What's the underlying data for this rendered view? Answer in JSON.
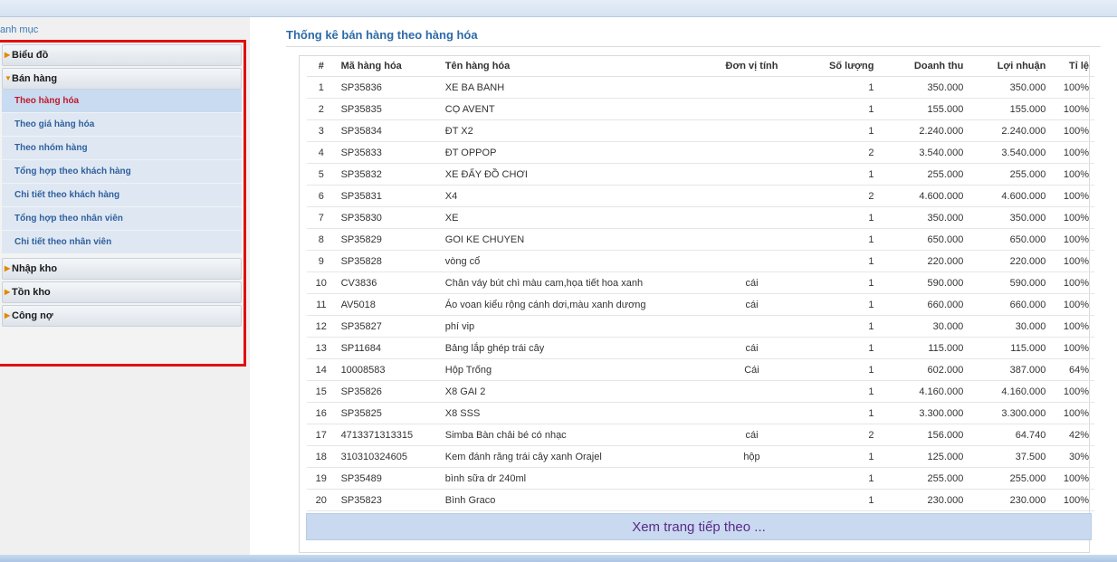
{
  "sidebar": {
    "title": "anh mục",
    "groups": {
      "chart": "Biểu đồ",
      "sales": "Bán hàng",
      "import": "Nhập kho",
      "stock": "Tồn kho",
      "debt": "Công nợ"
    },
    "sales_items": [
      "Theo hàng hóa",
      "Theo giá hàng hóa",
      "Theo nhóm hàng",
      "Tổng hợp theo khách hàng",
      "Chi tiết theo khách hàng",
      "Tổng hợp theo nhân viên",
      "Chi tiết theo nhân viên"
    ]
  },
  "main": {
    "title": "Thống kê bán hàng theo hàng hóa",
    "columns": [
      "#",
      "Mã hàng hóa",
      "Tên hàng hóa",
      "Đơn vị tính",
      "Số lượng",
      "Doanh thu",
      "Lợi nhuận",
      "Tỉ lệ"
    ],
    "rows": [
      [
        "1",
        "SP35836",
        "XE BA BANH",
        "",
        "1",
        "350.000",
        "350.000",
        "100%"
      ],
      [
        "2",
        "SP35835",
        "CỌ AVENT",
        "",
        "1",
        "155.000",
        "155.000",
        "100%"
      ],
      [
        "3",
        "SP35834",
        "ĐT X2",
        "",
        "1",
        "2.240.000",
        "2.240.000",
        "100%"
      ],
      [
        "4",
        "SP35833",
        "ĐT OPPOP",
        "",
        "2",
        "3.540.000",
        "3.540.000",
        "100%"
      ],
      [
        "5",
        "SP35832",
        "XE ĐẨY ĐỒ CHƠI",
        "",
        "1",
        "255.000",
        "255.000",
        "100%"
      ],
      [
        "6",
        "SP35831",
        "X4",
        "",
        "2",
        "4.600.000",
        "4.600.000",
        "100%"
      ],
      [
        "7",
        "SP35830",
        "XE",
        "",
        "1",
        "350.000",
        "350.000",
        "100%"
      ],
      [
        "8",
        "SP35829",
        "GOI KE CHUYEN",
        "",
        "1",
        "650.000",
        "650.000",
        "100%"
      ],
      [
        "9",
        "SP35828",
        "vòng cổ",
        "",
        "1",
        "220.000",
        "220.000",
        "100%"
      ],
      [
        "10",
        "CV3836",
        "Chân váy bút chì màu cam,họa tiết hoa xanh",
        "cái",
        "1",
        "590.000",
        "590.000",
        "100%"
      ],
      [
        "11",
        "AV5018",
        "Áo voan kiểu rộng cánh dơi,màu xanh dương",
        "cái",
        "1",
        "660.000",
        "660.000",
        "100%"
      ],
      [
        "12",
        "SP35827",
        "phí vip",
        "",
        "1",
        "30.000",
        "30.000",
        "100%"
      ],
      [
        "13",
        "SP11684",
        "Bảng lắp ghép trái cây",
        "cái",
        "1",
        "115.000",
        "115.000",
        "100%"
      ],
      [
        "14",
        "10008583",
        "Hộp Trống",
        "Cái",
        "1",
        "602.000",
        "387.000",
        "64%"
      ],
      [
        "15",
        "SP35826",
        "X8 GAI 2",
        "",
        "1",
        "4.160.000",
        "4.160.000",
        "100%"
      ],
      [
        "16",
        "SP35825",
        "X8 SSS",
        "",
        "1",
        "3.300.000",
        "3.300.000",
        "100%"
      ],
      [
        "17",
        "4713371313315",
        "Simba Bàn chải bé có nhạc",
        "cái",
        "2",
        "156.000",
        "64.740",
        "42%"
      ],
      [
        "18",
        "310310324605",
        "Kem đánh răng trái cây xanh Orajel",
        "hộp",
        "1",
        "125.000",
        "37.500",
        "30%"
      ],
      [
        "19",
        "SP35489",
        "bình sữa dr 240ml",
        "",
        "1",
        "255.000",
        "255.000",
        "100%"
      ],
      [
        "20",
        "SP35823",
        "Bình Graco",
        "",
        "1",
        "230.000",
        "230.000",
        "100%"
      ]
    ],
    "more_label": "Xem trang tiếp theo ..."
  }
}
